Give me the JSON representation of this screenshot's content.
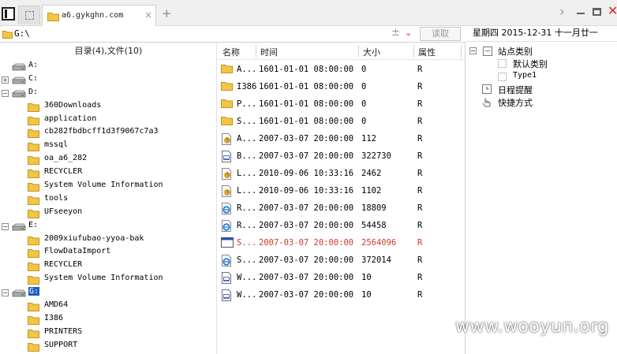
{
  "tabbar": {
    "tab_title": "a6.gykghn.com",
    "new_tab": "+",
    "close_tab": "×",
    "chevron": "›",
    "window_close": "✕"
  },
  "address": {
    "path": "G:\\",
    "dots": "±",
    "dropdown": "⌄",
    "read_button": "读取"
  },
  "tree": {
    "header": "目录(4),文件(10)",
    "rows": [
      {
        "label": "A:",
        "level": 0,
        "toggle": ""
      },
      {
        "label": "C:",
        "level": 0,
        "toggle": "+"
      },
      {
        "label": "D:",
        "level": 0,
        "toggle": "−"
      },
      {
        "label": "360Downloads",
        "level": 1
      },
      {
        "label": "application",
        "level": 1
      },
      {
        "label": "cb282fbdbcff1d3f9067c7a3",
        "level": 1
      },
      {
        "label": "mssql",
        "level": 1
      },
      {
        "label": "oa_a6_282",
        "level": 1
      },
      {
        "label": "RECYCLER",
        "level": 1
      },
      {
        "label": "System Volume Information",
        "level": 1
      },
      {
        "label": "tools",
        "level": 1
      },
      {
        "label": "UFseeyon",
        "level": 1
      },
      {
        "label": "E:",
        "level": 0,
        "toggle": "−"
      },
      {
        "label": "2009xiufubao-yyoa-bak",
        "level": 1
      },
      {
        "label": "FlowDataImport",
        "level": 1
      },
      {
        "label": "RECYCLER",
        "level": 1
      },
      {
        "label": "System Volume Information",
        "level": 1
      },
      {
        "label": "G:",
        "level": 0,
        "toggle": "−",
        "selected": true
      },
      {
        "label": "AMD64",
        "level": 1
      },
      {
        "label": "I386",
        "level": 1
      },
      {
        "label": "PRINTERS",
        "level": 1
      },
      {
        "label": "SUPPORT",
        "level": 1
      }
    ]
  },
  "files": {
    "columns": {
      "name": "名称",
      "time": "时间",
      "size": "大小",
      "attr": "属性"
    },
    "rows": [
      {
        "icon": "folder-icon",
        "name": "A...",
        "time": "1601-01-01 08:00:00",
        "size": "0",
        "attr": "R"
      },
      {
        "icon": "folder-icon",
        "name": "I386",
        "time": "1601-01-01 08:00:00",
        "size": "0",
        "attr": "R"
      },
      {
        "icon": "folder-icon",
        "name": "P...",
        "time": "1601-01-01 08:00:00",
        "size": "0",
        "attr": "R"
      },
      {
        "icon": "folder-icon",
        "name": "S...",
        "time": "1601-01-01 08:00:00",
        "size": "0",
        "attr": "R"
      },
      {
        "icon": "autorun-icon",
        "name": "A...",
        "time": "2007-03-07 20:00:00",
        "size": "112",
        "attr": "R"
      },
      {
        "icon": "bat-file-icon",
        "name": "B...",
        "time": "2007-03-07 20:00:00",
        "size": "322730",
        "attr": "R"
      },
      {
        "icon": "autorun-icon",
        "name": "L...",
        "time": "2010-09-06 10:33:16",
        "size": "2462",
        "attr": "R"
      },
      {
        "icon": "autorun-icon",
        "name": "L...",
        "time": "2010-09-06 10:33:16",
        "size": "1102",
        "attr": "R"
      },
      {
        "icon": "ie-file-icon",
        "name": "R...",
        "time": "2007-03-07 20:00:00",
        "size": "18809",
        "attr": "R"
      },
      {
        "icon": "ie-file-icon",
        "name": "R...",
        "time": "2007-03-07 20:00:00",
        "size": "54458",
        "attr": "R"
      },
      {
        "icon": "exe-file-icon",
        "name": "S...",
        "time": "2007-03-07 20:00:00",
        "size": "2564096",
        "attr": "R",
        "highlight": true
      },
      {
        "icon": "ie-file-icon",
        "name": "S...",
        "time": "2007-03-07 20:00:00",
        "size": "372014",
        "attr": "R"
      },
      {
        "icon": "bat-file-icon",
        "name": "W...",
        "time": "2007-03-07 20:00:00",
        "size": "10",
        "attr": "R"
      },
      {
        "icon": "bat-file-icon",
        "name": "W...",
        "time": "2007-03-07 20:00:00",
        "size": "10",
        "attr": "R"
      }
    ]
  },
  "side": {
    "date": "星期四 2015-12-31 十一月廿一",
    "site_category": "站点类别",
    "default_category": "默认类别",
    "type1": "Type1",
    "schedule": "日程提醒",
    "shortcut": "快捷方式"
  },
  "watermark": "www.wooyun.org",
  "colors": {
    "selection": "#1c5fbd",
    "highlight_row": "#d23a2e",
    "folder": "#f2c545",
    "close_red": "#d72a22"
  }
}
